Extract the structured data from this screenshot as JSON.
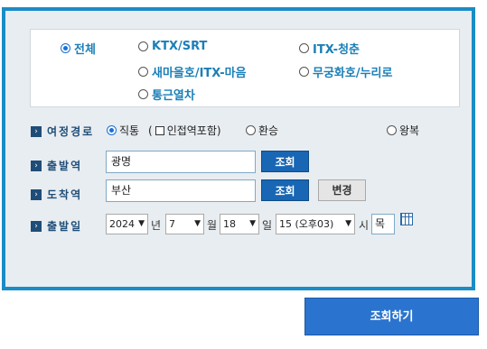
{
  "train_types": [
    {
      "label": "전체",
      "checked": true
    },
    {
      "label": "KTX/SRT",
      "checked": false
    },
    {
      "label": "ITX-청춘",
      "checked": false
    },
    {
      "label": "새마을호/ITX-마음",
      "checked": false
    },
    {
      "label": "무궁화호/누리로",
      "checked": false
    },
    {
      "label": "통근열차",
      "checked": false
    }
  ],
  "route": {
    "label": "여정경로",
    "direct": "직통",
    "include_prefix": "(",
    "include_nearby": "인접역포함)",
    "transfer": "환승",
    "round_trip": "왕복"
  },
  "departure": {
    "label": "출발역",
    "value": "광명",
    "search_button": "조회"
  },
  "arrival": {
    "label": "도착역",
    "value": "부산",
    "search_button": "조회",
    "swap_button": "변경"
  },
  "date": {
    "label": "출발일",
    "year": "2024",
    "year_unit": "년",
    "month": "7",
    "month_unit": "월",
    "day": "18",
    "day_unit": "일",
    "hour": "15 (오후03)",
    "hour_unit": "시",
    "weekday": "목"
  },
  "submit_button": "조회하기",
  "icons": {
    "bullet": "arrow-bullet-icon",
    "calendar": "calendar-icon",
    "dropdown": "chevron-down-icon"
  },
  "colors": {
    "panel_border": "#1a8cc6",
    "accent": "#1866b4",
    "label": "#1f4d78",
    "train_text": "#1a7fb8"
  }
}
